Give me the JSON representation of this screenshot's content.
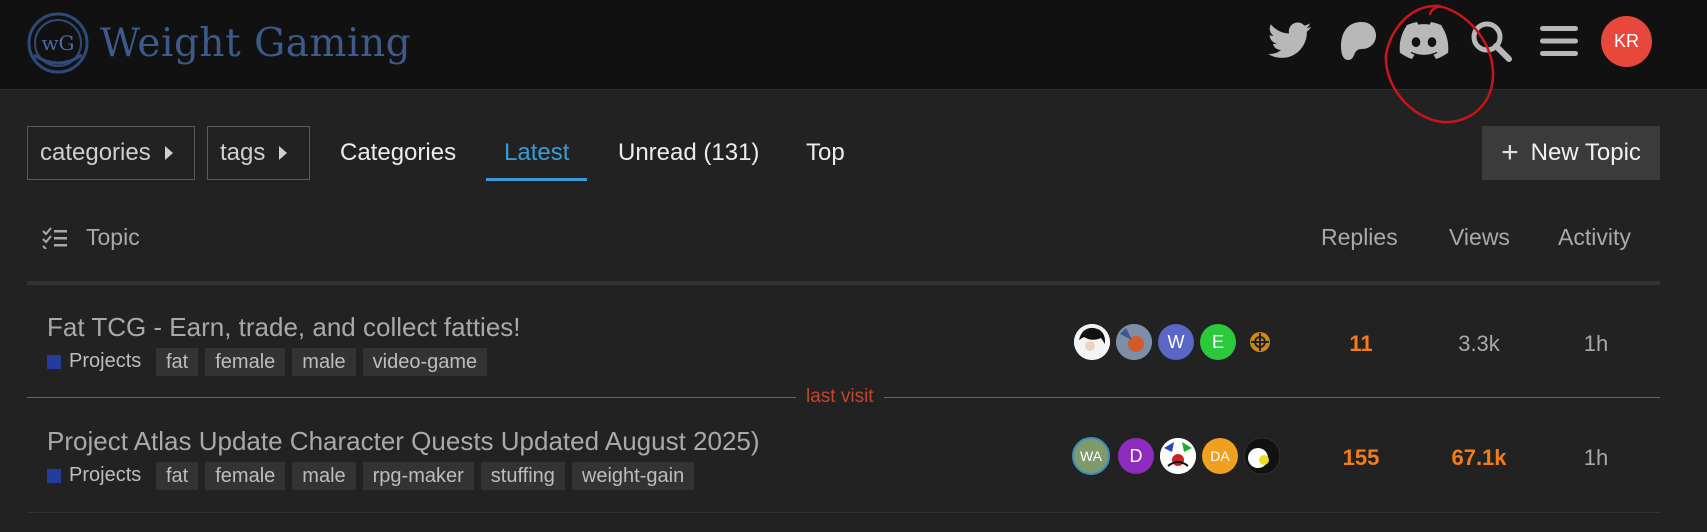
{
  "header": {
    "site_name": "Weight Gaming",
    "logo_letters": "wG",
    "icons": [
      "twitter-icon",
      "patreon-icon",
      "discord-icon",
      "search-icon",
      "hamburger-menu-icon"
    ],
    "user_initials": "KR",
    "user_avatar_color": "#e8473b"
  },
  "nav": {
    "categories_dropdown": "categories",
    "tags_dropdown": "tags",
    "links": [
      "Categories",
      "Latest",
      "Unread (131)",
      "Top"
    ],
    "active": "Latest",
    "new_topic": "New Topic"
  },
  "table": {
    "columns": [
      "Topic",
      "Replies",
      "Views",
      "Activity"
    ],
    "rows": [
      {
        "title": "Fat TCG - Earn, trade, and collect fatties!",
        "category": "Projects",
        "tags": [
          "fat",
          "female",
          "male",
          "video-game"
        ],
        "posters": [
          {
            "kind": "image",
            "name": "poster-avatar-1"
          },
          {
            "kind": "image",
            "name": "poster-avatar-2"
          },
          {
            "kind": "letter",
            "text": "W",
            "color": "#5b67c4"
          },
          {
            "kind": "letter",
            "text": "E",
            "color": "#2bc93c"
          },
          {
            "kind": "image",
            "name": "poster-avatar-5"
          }
        ],
        "replies": "11",
        "views": "3.3k",
        "activity": "1h"
      },
      {
        "title": "Project Atlas Update Character Quests Updated August 2025)",
        "category": "Projects",
        "tags": [
          "fat",
          "female",
          "male",
          "rpg-maker",
          "stuffing",
          "weight-gain"
        ],
        "posters": [
          {
            "kind": "letter",
            "text": "WA",
            "color": "#7f9a6b"
          },
          {
            "kind": "letter",
            "text": "D",
            "color": "#8e2bbf"
          },
          {
            "kind": "image",
            "name": "poster-avatar-3"
          },
          {
            "kind": "letter",
            "text": "DA",
            "color": "#f0a020"
          },
          {
            "kind": "image",
            "name": "poster-avatar-4"
          }
        ],
        "replies": "155",
        "views": "67.1k",
        "activity": "1h"
      }
    ],
    "last_visit_label": "last visit"
  },
  "colors": {
    "accent": "#3a9bd6",
    "hot": "#f57c18",
    "category": "#223d9c",
    "last_visit": "#c0462f"
  }
}
